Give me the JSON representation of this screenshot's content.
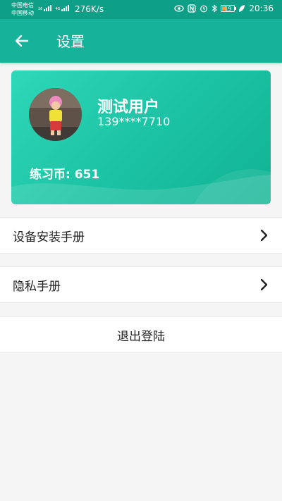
{
  "status_bar": {
    "carrier_1": "中国电信",
    "carrier_2": "中国移动",
    "net_1": "26",
    "net_2": "4G",
    "speed": "276K/s",
    "battery": "19",
    "time": "20:36"
  },
  "app_bar": {
    "title": "设置",
    "back_icon": "arrow-left-icon"
  },
  "profile": {
    "name": "测试用户",
    "phone": "139****7710",
    "coins": "练习币: 651"
  },
  "menu": {
    "items": [
      {
        "label": "设备安装手册",
        "icon": "chevron-right-icon"
      },
      {
        "label": "隐私手册",
        "icon": "chevron-right-icon"
      }
    ],
    "logout": "退出登陆"
  },
  "colors": {
    "status_bar": "#0e9f87",
    "app_bar": "#16b39a",
    "card_start": "#2fd8b8",
    "card_end": "#10b394",
    "background": "#f5f5f5"
  }
}
